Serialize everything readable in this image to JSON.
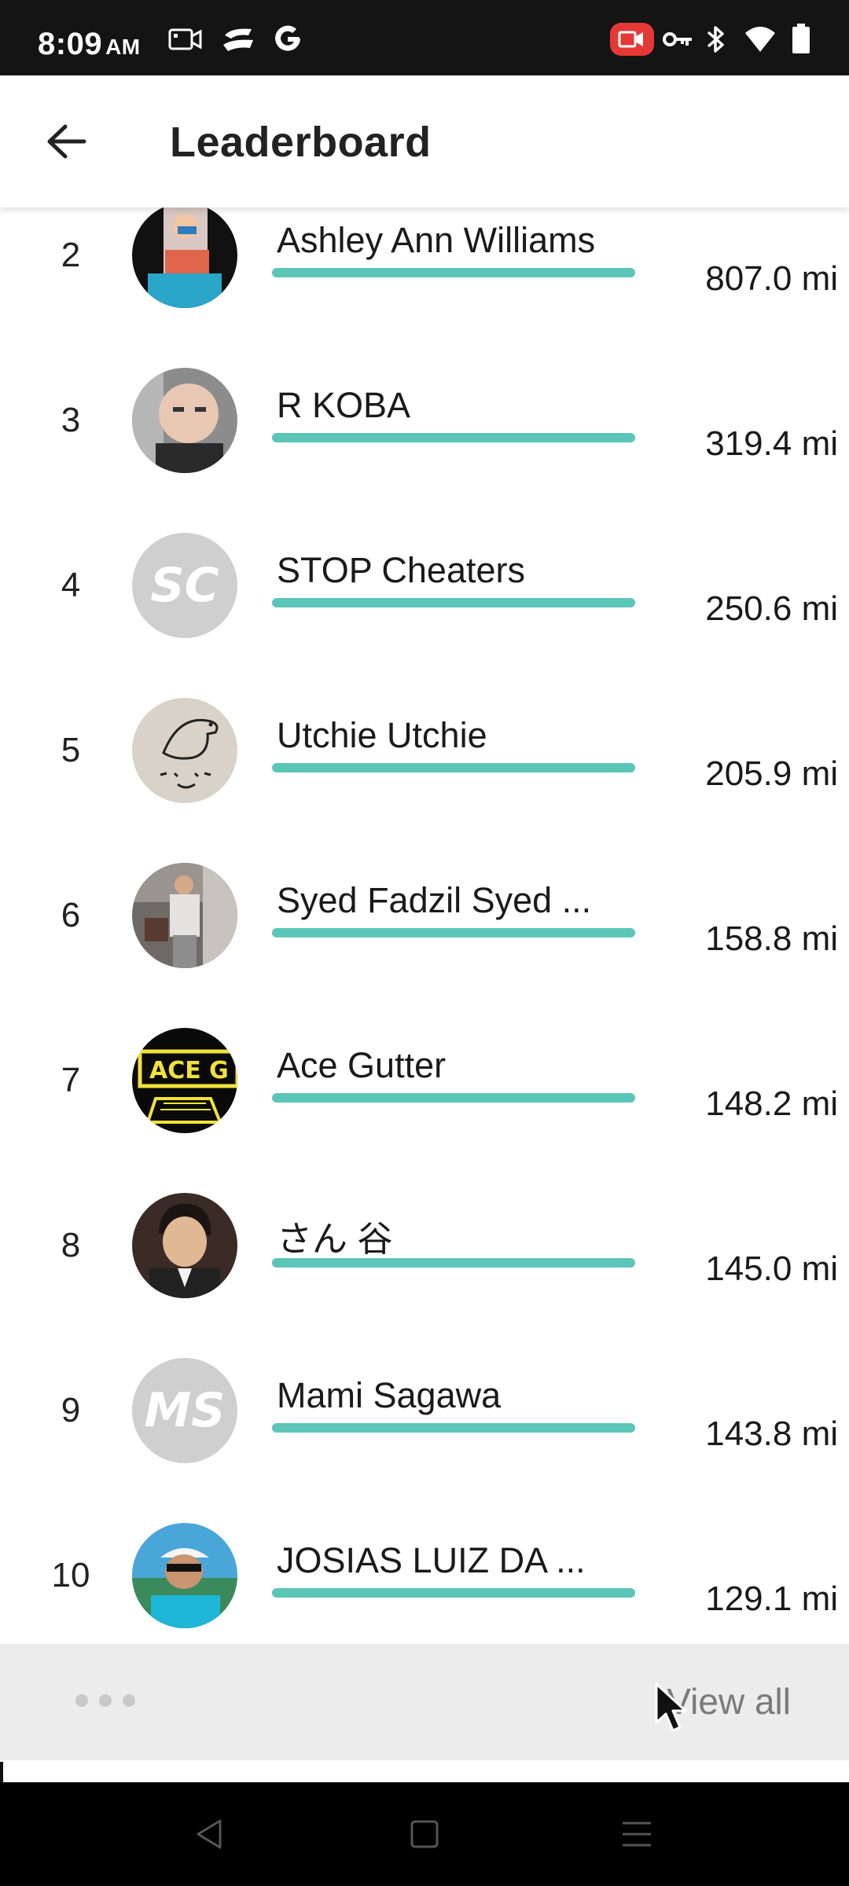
{
  "status_bar": {
    "time": "8:09",
    "ampm": "AM",
    "left_icons": [
      "video-camera-icon",
      "game-pad-icon",
      "google-g-icon"
    ],
    "right_icons": [
      "screen-record-icon",
      "vpn-key-icon",
      "bluetooth-icon",
      "wifi-icon",
      "battery-icon"
    ],
    "record_color": "#e53935"
  },
  "header": {
    "title": "Leaderboard"
  },
  "accent_color": "#5bc6b8",
  "leaderboard": [
    {
      "rank": "2",
      "name": "Ashley Ann Williams",
      "distance": "807.0 mi",
      "avatar": "photo",
      "progress": 1.0
    },
    {
      "rank": "3",
      "name": "R KOBA",
      "distance": "319.4 mi",
      "avatar": "photo",
      "progress": 1.0
    },
    {
      "rank": "4",
      "name": "STOP Cheaters",
      "distance": "250.6 mi",
      "avatar": "initials",
      "initials": "SC",
      "progress": 1.0
    },
    {
      "rank": "5",
      "name": "Utchie Utchie",
      "distance": "205.9 mi",
      "avatar": "drawing",
      "progress": 1.0
    },
    {
      "rank": "6",
      "name": "Syed Fadzil Syed ...",
      "distance": "158.8 mi",
      "avatar": "photo",
      "progress": 1.0
    },
    {
      "rank": "7",
      "name": "Ace Gutter",
      "distance": "148.2 mi",
      "avatar": "photo",
      "progress": 1.0
    },
    {
      "rank": "8",
      "name": "さん 谷",
      "distance": "145.0 mi",
      "avatar": "photo",
      "progress": 1.0
    },
    {
      "rank": "9",
      "name": "Mami Sagawa",
      "distance": "143.8 mi",
      "avatar": "initials",
      "initials": "MS",
      "progress": 1.0
    },
    {
      "rank": "10",
      "name": "JOSIAS LUIZ DA ...",
      "distance": "129.1 mi",
      "avatar": "photo",
      "progress": 1.0
    }
  ],
  "footer": {
    "more_icon": "more-dots-icon",
    "view_all_label": "View all"
  },
  "nav": {
    "buttons": [
      "back-triangle-icon",
      "home-square-icon",
      "menu-lines-icon"
    ]
  }
}
